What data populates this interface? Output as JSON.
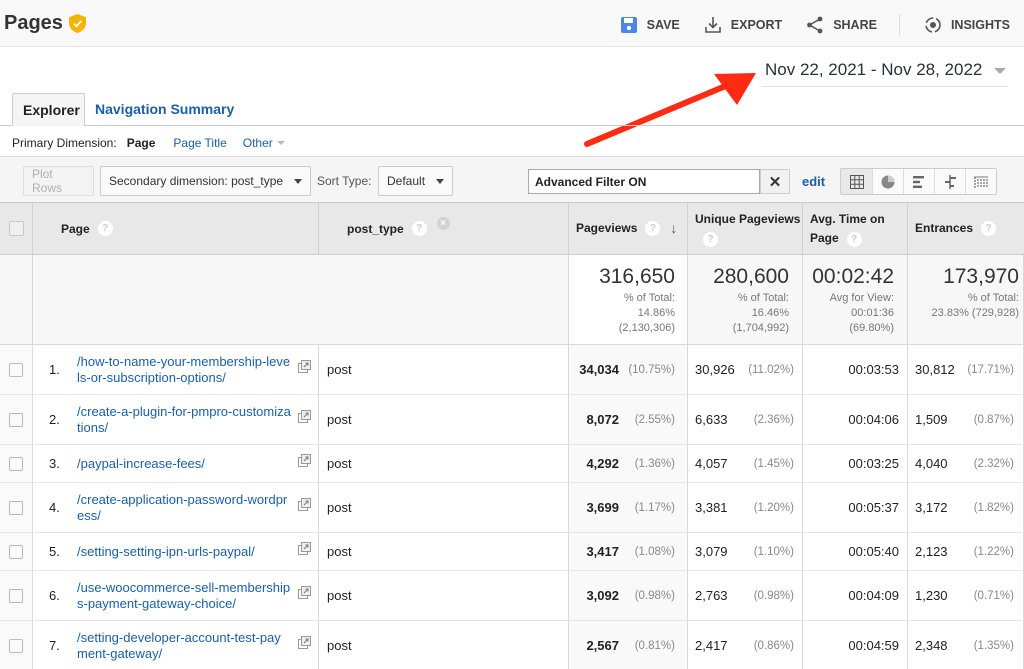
{
  "header": {
    "title": "Pages",
    "verified_icon": "shield-check-icon",
    "actions": [
      {
        "label": "SAVE",
        "icon": "save-icon"
      },
      {
        "label": "EXPORT",
        "icon": "download-icon"
      },
      {
        "label": "SHARE",
        "icon": "share-icon"
      },
      {
        "label": "INSIGHTS",
        "icon": "insights-icon"
      }
    ]
  },
  "date_range": "Nov 22, 2021 - Nov 28, 2022",
  "annotation": {
    "type": "arrow",
    "color": "#ff2a12",
    "points_to": "date_range"
  },
  "tabs": [
    {
      "label": "Explorer",
      "active": true
    },
    {
      "label": "Navigation Summary",
      "active": false
    }
  ],
  "primary_dimension": {
    "label": "Primary Dimension:",
    "active": "Page",
    "options": [
      "Page Title",
      "Other"
    ]
  },
  "toolbar": {
    "plot_rows": "Plot Rows",
    "secondary_dimension": "Secondary dimension: post_type",
    "sort_type_label": "Sort Type:",
    "sort_type_value": "Default",
    "filter_value": "Advanced Filter ON",
    "clear_symbol": "✕",
    "edit_label": "edit",
    "view_modes": [
      "table-view-icon",
      "pie-view-icon",
      "performance-view-icon",
      "comparison-view-icon",
      "pivot-view-icon"
    ]
  },
  "table": {
    "columns": [
      {
        "label": "Page"
      },
      {
        "label": "post_type"
      },
      {
        "label": "Pageviews",
        "sorted": "desc"
      },
      {
        "label": "Unique Pageviews"
      },
      {
        "label": "Avg. Time on Page"
      },
      {
        "label": "Entrances"
      }
    ],
    "help_symbol": "?",
    "remove_symbol": "×",
    "sort_symbol": "↓",
    "totals": {
      "pageviews": {
        "value": "316,650",
        "l1": "% of Total:",
        "l2": "14.86%",
        "l3": "(2,130,306)"
      },
      "unique_pageviews": {
        "value": "280,600",
        "l1": "% of Total:",
        "l2": "16.46%",
        "l3": "(1,704,992)"
      },
      "avg_time": {
        "value": "00:02:42",
        "l1": "Avg for View:",
        "l2": "00:01:36",
        "l3": "(69.80%)"
      },
      "entrances": {
        "value": "173,970",
        "l1": "% of Total:",
        "l2": "23.83% (729,928)"
      }
    },
    "rows": [
      {
        "n": "1.",
        "page": "/how-to-name-your-membership-levels-or-subscription-options/",
        "type": "post",
        "pv": "34,034",
        "pv_pct": "(10.75%)",
        "upv": "30,926",
        "upv_pct": "(11.02%)",
        "avg": "00:03:53",
        "ent": "30,812",
        "ent_pct": "(17.71%)"
      },
      {
        "n": "2.",
        "page": "/create-a-plugin-for-pmpro-customizations/",
        "type": "post",
        "pv": "8,072",
        "pv_pct": "(2.55%)",
        "upv": "6,633",
        "upv_pct": "(2.36%)",
        "avg": "00:04:06",
        "ent": "1,509",
        "ent_pct": "(0.87%)"
      },
      {
        "n": "3.",
        "page": "/paypal-increase-fees/",
        "type": "post",
        "pv": "4,292",
        "pv_pct": "(1.36%)",
        "upv": "4,057",
        "upv_pct": "(1.45%)",
        "avg": "00:03:25",
        "ent": "4,040",
        "ent_pct": "(2.32%)"
      },
      {
        "n": "4.",
        "page": "/create-application-password-wordpress/",
        "type": "post",
        "pv": "3,699",
        "pv_pct": "(1.17%)",
        "upv": "3,381",
        "upv_pct": "(1.20%)",
        "avg": "00:05:37",
        "ent": "3,172",
        "ent_pct": "(1.82%)"
      },
      {
        "n": "5.",
        "page": "/setting-setting-ipn-urls-paypal/",
        "type": "post",
        "pv": "3,417",
        "pv_pct": "(1.08%)",
        "upv": "3,079",
        "upv_pct": "(1.10%)",
        "avg": "00:05:40",
        "ent": "2,123",
        "ent_pct": "(1.22%)"
      },
      {
        "n": "6.",
        "page": "/use-woocommerce-sell-memberships-payment-gateway-choice/",
        "type": "post",
        "pv": "3,092",
        "pv_pct": "(0.98%)",
        "upv": "2,763",
        "upv_pct": "(0.98%)",
        "avg": "00:04:09",
        "ent": "1,230",
        "ent_pct": "(0.71%)"
      },
      {
        "n": "7.",
        "page": "/setting-developer-account-test-payment-gateway/",
        "type": "post",
        "pv": "2,567",
        "pv_pct": "(0.81%)",
        "upv": "2,417",
        "upv_pct": "(0.86%)",
        "avg": "00:04:59",
        "ent": "2,348",
        "ent_pct": "(1.35%)"
      }
    ]
  }
}
